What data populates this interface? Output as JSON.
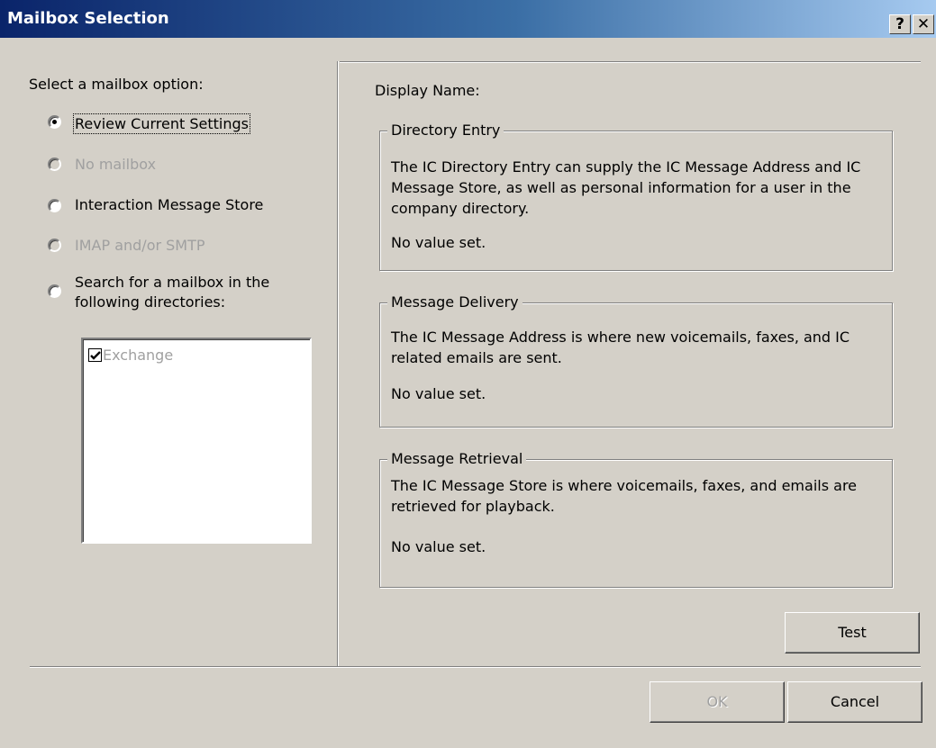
{
  "window": {
    "title": "Mailbox Selection",
    "help_glyph": "?",
    "close_glyph": "✕"
  },
  "left": {
    "heading": "Select a mailbox option:",
    "options": [
      {
        "label": "Review Current Settings",
        "selected": true,
        "enabled": true,
        "mnemonic": "R"
      },
      {
        "label": "No mailbox",
        "selected": false,
        "enabled": false,
        "mnemonic": "N"
      },
      {
        "label": "Interaction Message Store",
        "selected": false,
        "enabled": true,
        "mnemonic": "I"
      },
      {
        "label": "IMAP and/or SMTP",
        "selected": false,
        "enabled": false,
        "mnemonic": "M"
      },
      {
        "label_line1": "Search for a mailbox in the",
        "label_line2": "following directories:",
        "selected": false,
        "enabled": true,
        "mnemonic": "S"
      }
    ],
    "directories": [
      {
        "label": "Exchange",
        "checked": true
      }
    ]
  },
  "right": {
    "display_name_label": "Display Name:",
    "groups": [
      {
        "title": "Directory Entry",
        "description": "The IC Directory Entry can supply the IC Message Address and IC Message Store, as well as personal information for a user in the company directory.",
        "value": "No value set."
      },
      {
        "title": "Message Delivery",
        "description": "The IC Message Address is where new voicemails, faxes, and IC related emails are sent.",
        "value": "No value set."
      },
      {
        "title": "Message Retrieval",
        "description": "The IC Message Store is where voicemails, faxes, and emails are retrieved for playback.",
        "value": "No value set."
      }
    ],
    "test_button": "Test"
  },
  "footer": {
    "ok_button": "OK",
    "cancel_button": "Cancel"
  }
}
